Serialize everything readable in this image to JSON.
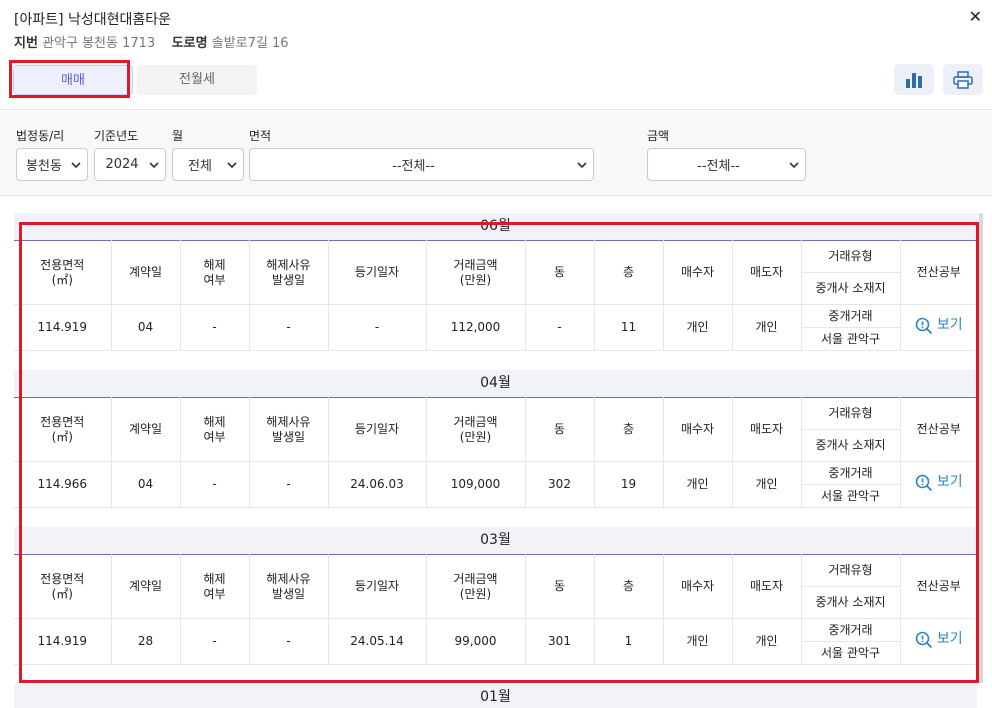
{
  "header": {
    "title": "[아파트] 낙성대현대홈타운",
    "jibun_label": "지번",
    "jibun_value": "관악구 봉천동 1713",
    "road_label": "도로명",
    "road_value": "솔밭로7길 16",
    "close_icon": "✕"
  },
  "tabs": {
    "sale": "매매",
    "rent": "전월세"
  },
  "filters": {
    "dong": {
      "label": "법정동/리",
      "value": "봉천동"
    },
    "year": {
      "label": "기준년도",
      "value": "2024"
    },
    "month": {
      "label": "월",
      "value": "전체"
    },
    "area": {
      "label": "면적",
      "value": "--전체--"
    },
    "price": {
      "label": "금액",
      "value": "--전체--"
    }
  },
  "columns": {
    "area_1": "전용면적",
    "area_2": "(㎡)",
    "contract_day": "계약일",
    "cancel_1": "해제",
    "cancel_2": "여부",
    "cancel_reason_1": "해제사유",
    "cancel_reason_2": "발생일",
    "reg_date": "등기일자",
    "price_1": "거래금액",
    "price_2": "(만원)",
    "building": "동",
    "floor": "층",
    "buyer": "매수자",
    "seller": "매도자",
    "deal_type": "거래유형",
    "agent_loc": "중개사 소재지",
    "registry": "전산공부"
  },
  "view_label": "보기",
  "months": [
    {
      "label": "06월",
      "row": {
        "area": "114.919",
        "day": "04",
        "cancel": "-",
        "cancel_date": "-",
        "reg_date": "-",
        "price": "112,000",
        "building": "-",
        "floor": "11",
        "buyer": "개인",
        "seller": "개인",
        "deal_type": "중개거래",
        "agent_loc": "서울 관악구"
      }
    },
    {
      "label": "04월",
      "row": {
        "area": "114.966",
        "day": "04",
        "cancel": "-",
        "cancel_date": "-",
        "reg_date": "24.06.03",
        "price": "109,000",
        "building": "302",
        "floor": "19",
        "buyer": "개인",
        "seller": "개인",
        "deal_type": "중개거래",
        "agent_loc": "서울 관악구"
      }
    },
    {
      "label": "03월",
      "row": {
        "area": "114.919",
        "day": "28",
        "cancel": "-",
        "cancel_date": "-",
        "reg_date": "24.05.14",
        "price": "99,000",
        "building": "301",
        "floor": "1",
        "buyer": "개인",
        "seller": "개인",
        "deal_type": "중개거래",
        "agent_loc": "서울 관악구"
      }
    },
    {
      "label": "01월"
    }
  ],
  "colors": {
    "accent": "#5a5ee0",
    "highlight": "#e3162c",
    "link": "#2e86c1",
    "header_line": "#6a73a6"
  }
}
